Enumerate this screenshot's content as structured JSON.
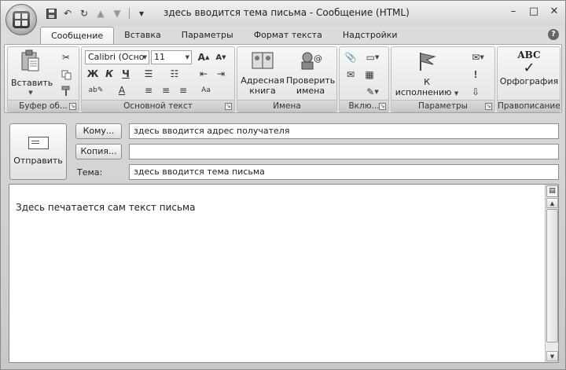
{
  "window": {
    "title": "здесь вводится тема письма - Сообщение (HTML)",
    "controls": [
      "–",
      "□",
      "✕"
    ]
  },
  "quick_access": [
    "save-icon",
    "undo-icon",
    "redo-icon",
    "up-arrow-icon",
    "down-arrow-icon",
    "customize-icon"
  ],
  "tabs": [
    {
      "label": "Сообщение",
      "active": true
    },
    {
      "label": "Вставка"
    },
    {
      "label": "Параметры"
    },
    {
      "label": "Формат текста"
    },
    {
      "label": "Надстройки"
    }
  ],
  "ribbon": {
    "clipboard": {
      "label": "Буфер об...",
      "paste": "Вставить"
    },
    "basic_text": {
      "label": "Основной текст",
      "font": "Calibri (Осно",
      "size": "11",
      "bold": "Ж",
      "italic": "К",
      "underline": "Ч"
    },
    "names": {
      "label": "Имена",
      "address_book": [
        "Адресная",
        "книга"
      ],
      "check_names": [
        "Проверить",
        "имена"
      ]
    },
    "include": {
      "label": "Вклю..."
    },
    "options": {
      "label": "Параметры",
      "follow_up": [
        "К",
        "исполнению"
      ]
    },
    "proofing": {
      "label": "Правописание",
      "spelling": "Орфография",
      "abc": "ABC"
    }
  },
  "form": {
    "send": "Отправить",
    "to_button": "Кому...",
    "to_value": "здесь вводится адрес получателя",
    "cc_button": "Копия...",
    "cc_value": "",
    "subject_label": "Тема:",
    "subject_value": "здесь вводится тема письма"
  },
  "body": {
    "text": "Здесь печатается сам текст письма"
  }
}
